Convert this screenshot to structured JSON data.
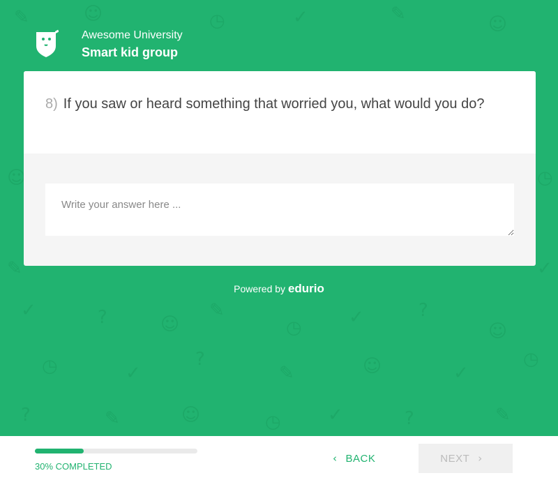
{
  "organization": {
    "name": "Awesome University",
    "group": "Smart kid group"
  },
  "question": {
    "number": "8)",
    "text": "If you saw or heard something that worried you, what would you do?"
  },
  "answer": {
    "placeholder": "Write your answer here ...",
    "value": ""
  },
  "powered_by": {
    "prefix": "Powered by",
    "brand": "edurio"
  },
  "progress": {
    "fraction": 0.3,
    "label": "30% COMPLETED"
  },
  "nav": {
    "back_label": "BACK",
    "next_label": "NEXT",
    "back_icon": "‹",
    "next_icon": "›"
  },
  "colors": {
    "brand_green": "#21b370",
    "pattern_green": "#1da867"
  }
}
